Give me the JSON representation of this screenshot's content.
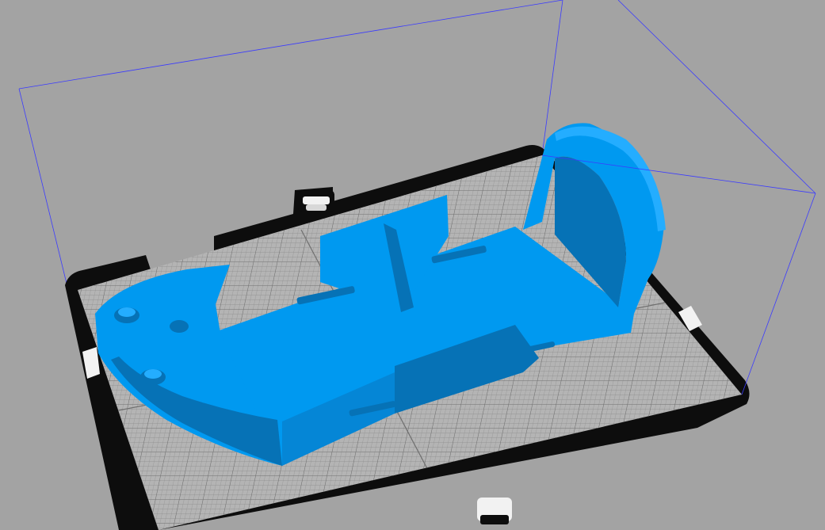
{
  "viewport": {
    "background_color": "#a3a3a3",
    "build_volume_color": "#3b3bff",
    "bed_frame_color": "#0d0d0d",
    "bed_surface_color": "#b4b4b4",
    "bed_grid_color": "#8a8a8a",
    "clip_color": "#f2f2f2",
    "model_color": "#0099f0",
    "model_shadow_color": "#0672b6",
    "model_highlight_color": "#24adff"
  },
  "objects": [
    {
      "name": "printed-part",
      "type": "mesh"
    }
  ]
}
